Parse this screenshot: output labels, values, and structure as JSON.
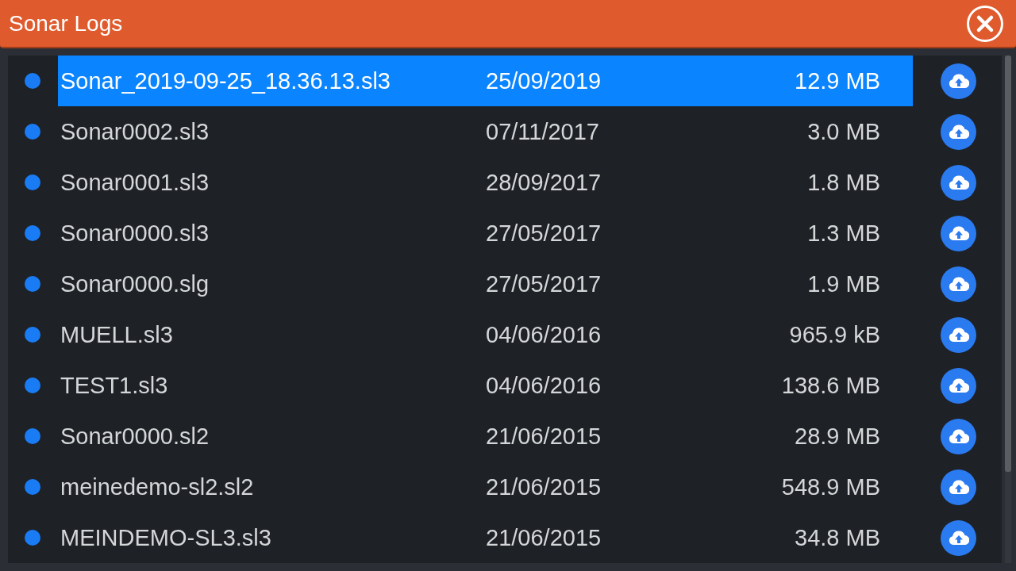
{
  "window": {
    "title": "Sonar Logs"
  },
  "files": [
    {
      "name": "Sonar_2019-09-25_18.36.13.sl3",
      "date": "25/09/2019",
      "size": "12.9 MB",
      "selected": true
    },
    {
      "name": "Sonar0002.sl3",
      "date": "07/11/2017",
      "size": "3.0 MB",
      "selected": false
    },
    {
      "name": "Sonar0001.sl3",
      "date": "28/09/2017",
      "size": "1.8 MB",
      "selected": false
    },
    {
      "name": "Sonar0000.sl3",
      "date": "27/05/2017",
      "size": "1.3 MB",
      "selected": false
    },
    {
      "name": "Sonar0000.slg",
      "date": "27/05/2017",
      "size": "1.9 MB",
      "selected": false
    },
    {
      "name": "MUELL.sl3",
      "date": "04/06/2016",
      "size": "965.9 kB",
      "selected": false
    },
    {
      "name": "TEST1.sl3",
      "date": "04/06/2016",
      "size": "138.6 MB",
      "selected": false
    },
    {
      "name": "Sonar0000.sl2",
      "date": "21/06/2015",
      "size": "28.9 MB",
      "selected": false
    },
    {
      "name": "meinedemo-sl2.sl2",
      "date": "21/06/2015",
      "size": "548.9 MB",
      "selected": false
    },
    {
      "name": "MEINDEMO-SL3.sl3",
      "date": "21/06/2015",
      "size": "34.8 MB",
      "selected": false
    }
  ]
}
